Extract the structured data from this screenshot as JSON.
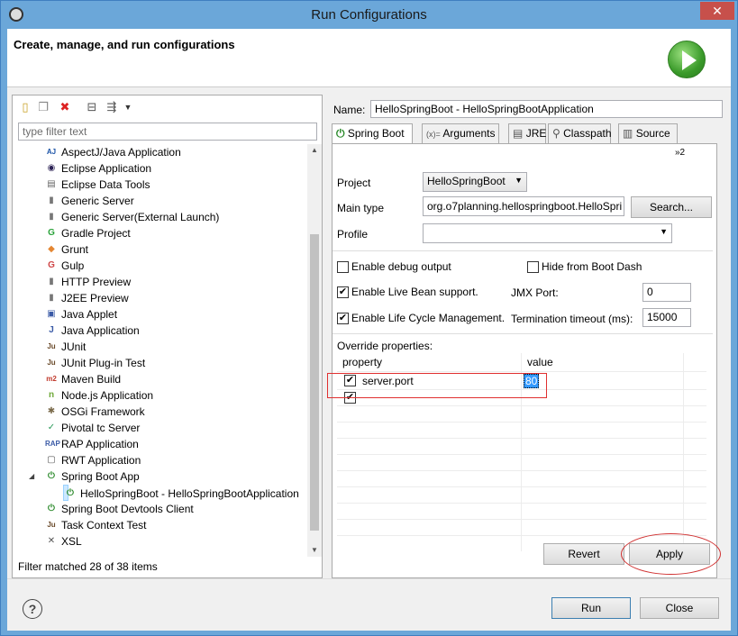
{
  "window": {
    "title": "Run Configurations",
    "close_glyph": "✕"
  },
  "header": {
    "title": "Create, manage, and run configurations"
  },
  "left": {
    "filter_placeholder": "type filter text",
    "tree": [
      {
        "label": "AspectJ/Java Application",
        "icon": "aspectj-icon",
        "glyph": "AJ",
        "color": "#1a52a6",
        "indent": 0
      },
      {
        "label": "Eclipse Application",
        "icon": "eclipse-icon",
        "glyph": "◉",
        "color": "#2c2255",
        "indent": 0
      },
      {
        "label": "Eclipse Data Tools",
        "icon": "database-icon",
        "glyph": "▤",
        "color": "#666",
        "indent": 0
      },
      {
        "label": "Generic Server",
        "icon": "server-icon",
        "glyph": "▮",
        "color": "#777",
        "indent": 0
      },
      {
        "label": "Generic Server(External Launch)",
        "icon": "server-icon",
        "glyph": "▮",
        "color": "#777",
        "indent": 0
      },
      {
        "label": "Gradle Project",
        "icon": "gradle-icon",
        "glyph": "G",
        "color": "#2aa33a",
        "indent": 0
      },
      {
        "label": "Grunt",
        "icon": "grunt-icon",
        "glyph": "◆",
        "color": "#e48632",
        "indent": 0
      },
      {
        "label": "Gulp",
        "icon": "gulp-icon",
        "glyph": "G",
        "color": "#cf4647",
        "indent": 0
      },
      {
        "label": "HTTP Preview",
        "icon": "server-icon",
        "glyph": "▮",
        "color": "#777",
        "indent": 0
      },
      {
        "label": "J2EE Preview",
        "icon": "server-icon",
        "glyph": "▮",
        "color": "#777",
        "indent": 0
      },
      {
        "label": "Java Applet",
        "icon": "applet-icon",
        "glyph": "▣",
        "color": "#3a5aa6",
        "indent": 0
      },
      {
        "label": "Java Application",
        "icon": "java-icon",
        "glyph": "J",
        "color": "#3a5aa6",
        "indent": 0
      },
      {
        "label": "JUnit",
        "icon": "junit-icon",
        "glyph": "Ju",
        "color": "#6a4a2a",
        "indent": 0
      },
      {
        "label": "JUnit Plug-in Test",
        "icon": "junit-plugin-icon",
        "glyph": "Ju",
        "color": "#6a4a2a",
        "indent": 0
      },
      {
        "label": "Maven Build",
        "icon": "maven-icon",
        "glyph": "m2",
        "color": "#c0392b",
        "indent": 0
      },
      {
        "label": "Node.js Application",
        "icon": "nodejs-icon",
        "glyph": "n",
        "color": "#6fa93a",
        "indent": 0
      },
      {
        "label": "OSGi Framework",
        "icon": "osgi-icon",
        "glyph": "✱",
        "color": "#7a6a4a",
        "indent": 0
      },
      {
        "label": "Pivotal tc Server",
        "icon": "pivotal-icon",
        "glyph": "✓",
        "color": "#2b9a5a",
        "indent": 0
      },
      {
        "label": "RAP Application",
        "icon": "rap-icon",
        "glyph": "RAP",
        "color": "#3a5aa6",
        "indent": 0
      },
      {
        "label": "RWT Application",
        "icon": "rwt-icon",
        "glyph": "▢",
        "color": "#555",
        "indent": 0
      },
      {
        "label": "Spring Boot App",
        "icon": "spring-boot-icon",
        "glyph": "⏻",
        "color": "#2b8a2b",
        "indent": 0,
        "expanded": true
      },
      {
        "label": "HelloSpringBoot - HelloSpringBootApplication",
        "icon": "spring-boot-icon",
        "glyph": "⏻",
        "color": "#2b8a2b",
        "indent": 1,
        "selected": true
      },
      {
        "label": "Spring Boot Devtools Client",
        "icon": "spring-boot-icon",
        "glyph": "⏻",
        "color": "#2b8a2b",
        "indent": 0
      },
      {
        "label": "Task Context Test",
        "icon": "task-test-icon",
        "glyph": "Ju",
        "color": "#6a4a2a",
        "indent": 0
      },
      {
        "label": "XSL",
        "icon": "xsl-icon",
        "glyph": "✕",
        "color": "#555",
        "indent": 0
      }
    ],
    "status": "Filter matched 28 of 38 items"
  },
  "right": {
    "name_label": "Name:",
    "name_value": "HelloSpringBoot - HelloSpringBootApplication",
    "tabs": [
      {
        "label": "Spring Boot",
        "glyph": "⏻"
      },
      {
        "label": "Arguments",
        "glyph": "(x)="
      },
      {
        "label": "JRE",
        "glyph": "▤"
      },
      {
        "label": "Classpath",
        "glyph": "⚲"
      },
      {
        "label": "Source",
        "glyph": "▥"
      }
    ],
    "overflow": "»2",
    "project_label": "Project",
    "project_value": "HelloSpringBoot",
    "main_type_label": "Main type",
    "main_type_value": "org.o7planning.hellospringboot.HelloSpri",
    "search_button": "Search...",
    "profile_label": "Profile",
    "profile_value": "",
    "enable_debug": "Enable debug output",
    "hide_boot_dash": "Hide from Boot Dash",
    "live_bean": "Enable Live Bean support.",
    "jmx_label": "JMX Port:",
    "jmx_value": "0",
    "life_cycle": "Enable Life Cycle Management.",
    "termination_label": "Termination timeout (ms):",
    "termination_value": "15000",
    "override_label": "Override properties:",
    "table": {
      "headers": [
        "property",
        "value"
      ],
      "rows": [
        {
          "checked": true,
          "property": "server.port",
          "value": "80"
        },
        {
          "checked": true,
          "property": "",
          "value": ""
        }
      ]
    },
    "revert_button": "Revert",
    "apply_button": "Apply"
  },
  "bottom": {
    "help_glyph": "?",
    "run_button": "Run",
    "close_button": "Close"
  },
  "colors": {
    "selection": "#cce8ff",
    "highlight": "#3399ff",
    "annotation": "#e03030"
  }
}
